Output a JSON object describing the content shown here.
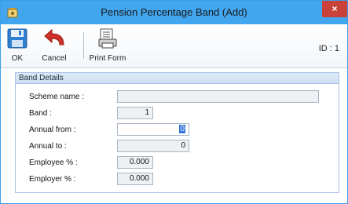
{
  "window": {
    "title": "Pension Percentage Band (Add)",
    "close_glyph": "×",
    "app_icon": "app-icon"
  },
  "toolbar": {
    "ok_label": "OK",
    "cancel_label": "Cancel",
    "print_label": "Print Form",
    "id_label": "ID : 1"
  },
  "group": {
    "header": "Band Details"
  },
  "fields": {
    "scheme_name": {
      "label": "Scheme name :",
      "value": ""
    },
    "band": {
      "label": "Band :",
      "value": "1"
    },
    "annual_from": {
      "label": "Annual from :",
      "value": "0"
    },
    "annual_to": {
      "label": "Annual to :",
      "value": "0"
    },
    "employee_pct": {
      "label": "Employee % :",
      "value": "0.000"
    },
    "employer_pct": {
      "label": "Employer % :",
      "value": "0.000"
    }
  },
  "colors": {
    "titlebar": "#42a6ef",
    "close": "#c9423a",
    "group_border": "#a9c3e6"
  }
}
